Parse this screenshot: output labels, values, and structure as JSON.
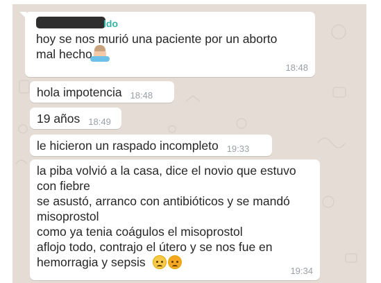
{
  "chat": {
    "background_color": "#e5ddd5",
    "bubble_color": "#ffffff",
    "sender_color": "#35b4a6"
  },
  "sender": {
    "name_suffix": "ldo"
  },
  "messages": [
    {
      "text": "hoy se nos murió una paciente por un aborto\nmal hecho",
      "time": "18:48",
      "emoji": [
        "person-shrugging"
      ]
    },
    {
      "text": "hola impotencia",
      "time": "18:48"
    },
    {
      "text": "19 años",
      "time": "18:49"
    },
    {
      "text": "le hicieron un raspado incompleto",
      "time": "19:33"
    },
    {
      "text": "la piba volvió a la casa, dice el novio que estuvo\ncon fiebre\nse asustó, arranco con antibióticos y se mandó\nmisoprostol\ncomo ya tenia coágulos el misoprostol\naflojo todo, contrajo el útero y se nos fue en\nhemorragia y sepsis",
      "time": "19:34",
      "emoji": [
        "disappointed-face",
        "angry-face"
      ]
    }
  ]
}
